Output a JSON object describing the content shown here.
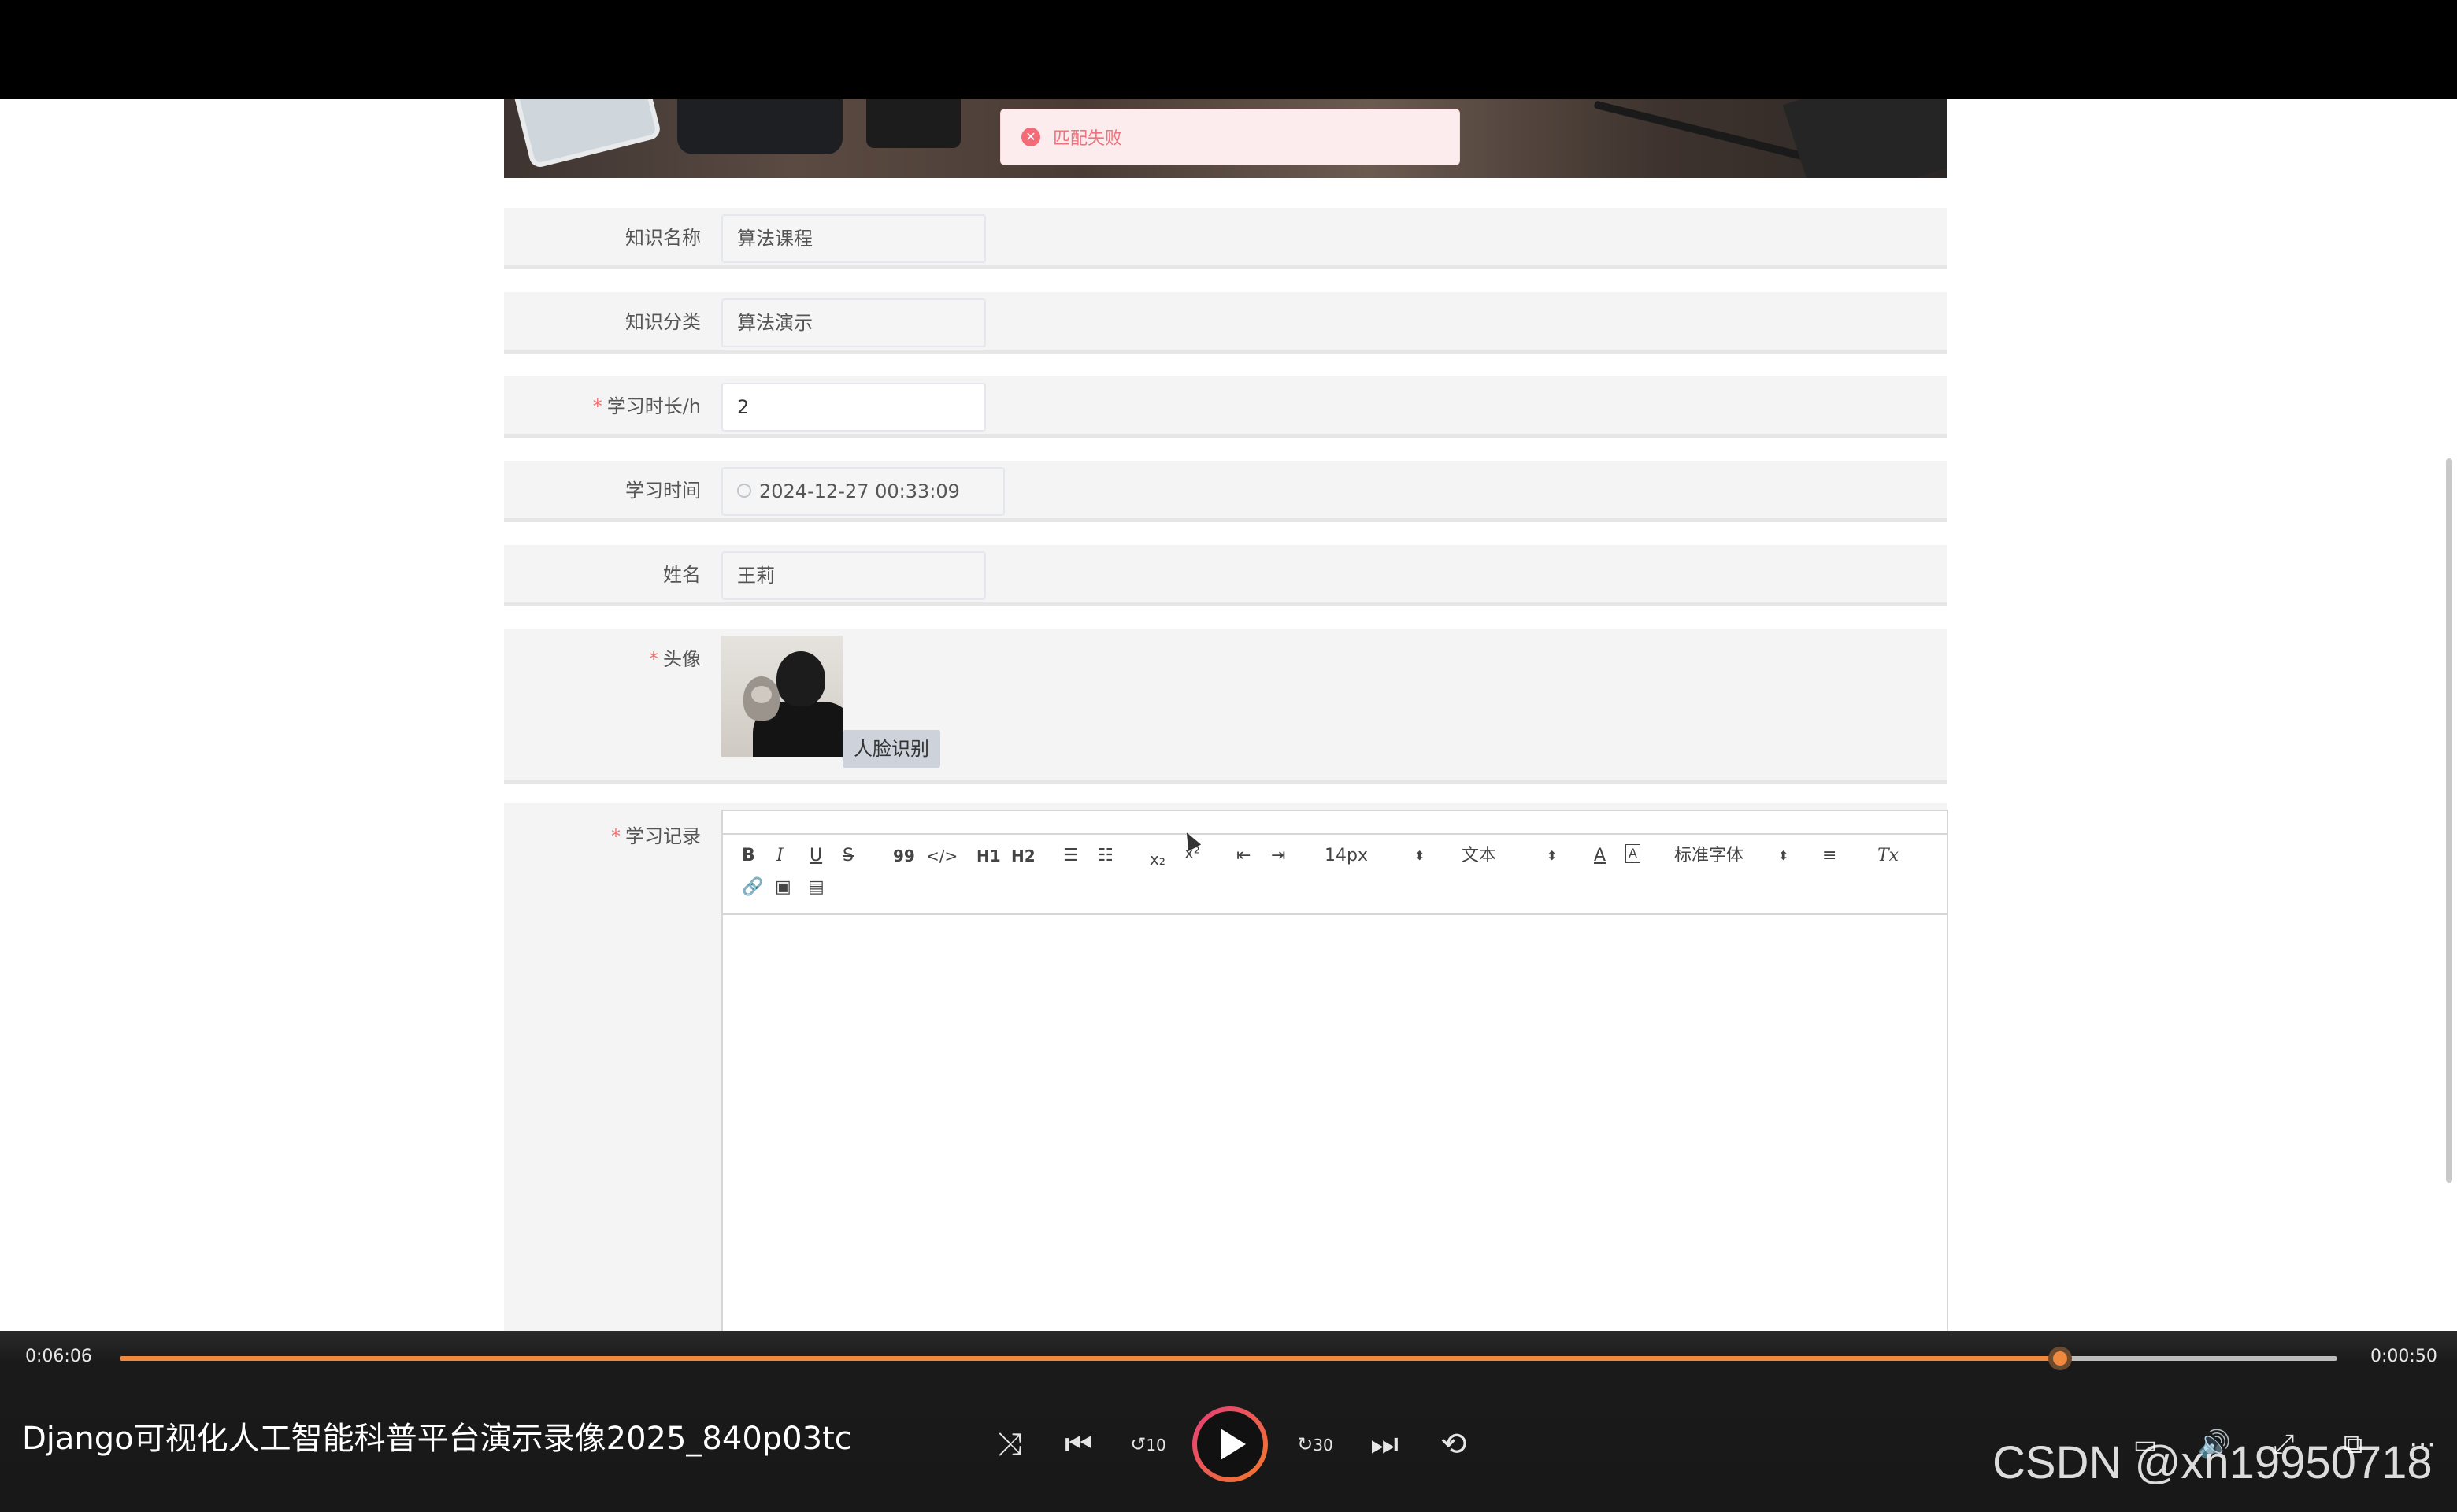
{
  "toast": {
    "message": "匹配失败",
    "icon": "error-circle-icon",
    "color": "#f56c6c"
  },
  "form": {
    "knowledge_name": {
      "label": "知识名称",
      "value": "算法课程",
      "required": false
    },
    "knowledge_category": {
      "label": "知识分类",
      "value": "算法演示",
      "required": false
    },
    "study_duration": {
      "label": "学习时长/h",
      "value": "2",
      "required": true
    },
    "study_time": {
      "label": "学习时间",
      "value": "2024-12-27 00:33:09",
      "required": false
    },
    "name": {
      "label": "姓名",
      "value": "王莉",
      "required": false
    },
    "avatar": {
      "label": "头像",
      "face_button": "人脸识别",
      "required": true
    },
    "study_record": {
      "label": "学习记录",
      "required": true,
      "toolbar": {
        "bold": "B",
        "italic": "I",
        "underline": "U",
        "strike": "S",
        "blockquote": "99",
        "code": "</>",
        "h1": "H1",
        "h2": "H2",
        "font_size": "14px",
        "block_type": "文本",
        "font_family": "标准字体",
        "icons": [
          "bold-icon",
          "italic-icon",
          "underline-icon",
          "strike-icon",
          "quote-icon",
          "code-icon",
          "h1-icon",
          "h2-icon",
          "ordered-list-icon",
          "bullet-list-icon",
          "subscript-icon",
          "superscript-icon",
          "outdent-icon",
          "indent-icon",
          "font-color-icon",
          "background-color-icon",
          "align-icon",
          "clear-format-icon",
          "link-icon",
          "image-icon",
          "video-icon"
        ]
      }
    },
    "required_mark": "*"
  },
  "player": {
    "elapsed": "0:06:06",
    "remaining": "0:00:50",
    "progress_fraction": 0.875,
    "title": "Django可视化人工智能科普平台演示录像2025_840p03tc",
    "accent_color": "#f0883e",
    "controls": [
      "shuffle-icon",
      "previous-icon",
      "rewind-10-icon",
      "play-icon",
      "forward-30-icon",
      "next-icon",
      "repeat-off-icon",
      "subtitles-icon",
      "volume-icon",
      "fullscreen-icon",
      "mini-player-icon",
      "more-icon"
    ],
    "rewind_label": "10",
    "forward_label": "30"
  },
  "watermark": "CSDN @xn19950718"
}
